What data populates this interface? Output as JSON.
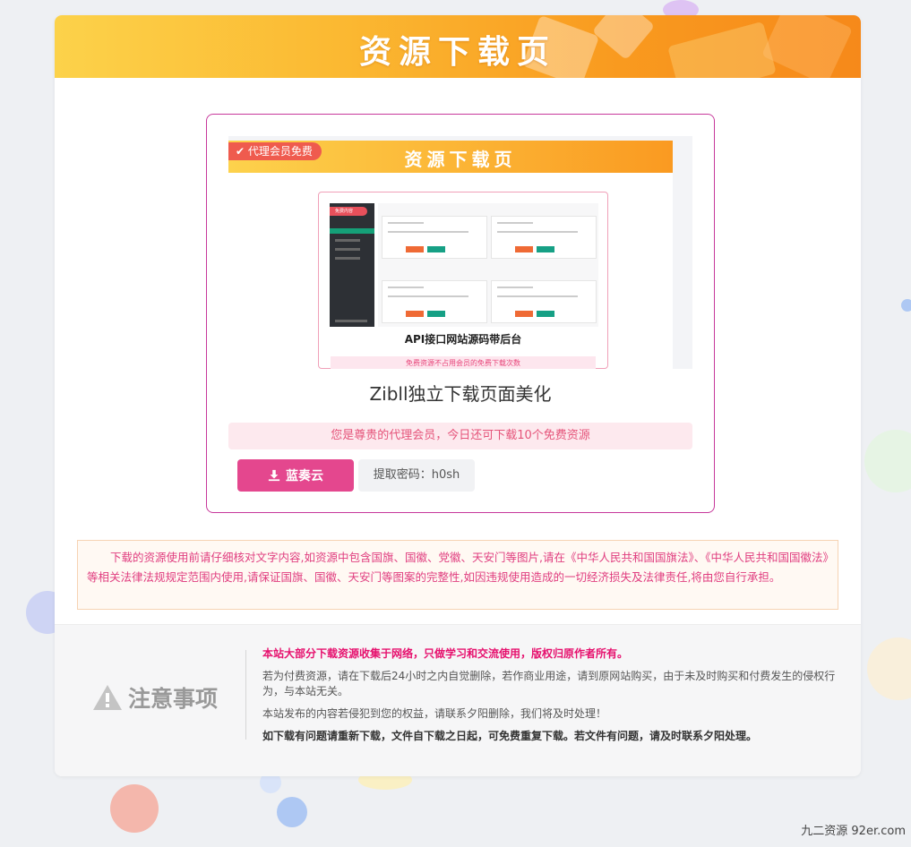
{
  "banner": {
    "title": "资源下载页"
  },
  "preview": {
    "badge": "代理会员免费",
    "banner_title": "资源下载页",
    "inner_badge": "免费内容",
    "caption": "API接口网站源码带后台",
    "strip_text": "免费资源不占用会员的免费下载次数"
  },
  "resource": {
    "title": "Zibll独立下载页面美化",
    "member_notice": "您是尊贵的代理会员，今日还可下载10个免费资源",
    "download_label": "蓝奏云",
    "password_label": "提取密码：h0sh"
  },
  "legal": {
    "text": "下载的资源使用前请仔细核对文字内容,如资源中包含国旗、国徽、党徽、天安门等图片,请在《中华人民共和国国旗法》、《中华人民共和国国徽法》等相关法律法规规定范围内使用,请保证国旗、国徽、天安门等图案的完整性,如因违规使用造成的一切经济损失及法律责任,将由您自行承担。"
  },
  "notice": {
    "title": "注意事项",
    "line1": "本站大部分下载资源收集于网络，只做学习和交流使用，版权归原作者所有。",
    "line2": "若为付费资源，请在下载后24小时之内自觉删除，若作商业用途，请到原网站购买，由于未及时购买和付费发生的侵权行为，与本站无关。",
    "line3": "本站发布的内容若侵犯到您的权益，请联系夕阳删除，我们将及时处理！",
    "line4": "如下载有问题请重新下载，文件自下载之日起，可免费重复下载。若文件有问题，请及时联系夕阳处理。"
  },
  "watermark": "九二资源 92er.com",
  "colors": {
    "accent": "#e4478e",
    "banner_start": "#fcd24a",
    "banner_end": "#f6891a",
    "highlight": "#e6116e"
  },
  "icons": {
    "download": "download-icon",
    "warning": "warning-icon",
    "check": "check-icon"
  }
}
